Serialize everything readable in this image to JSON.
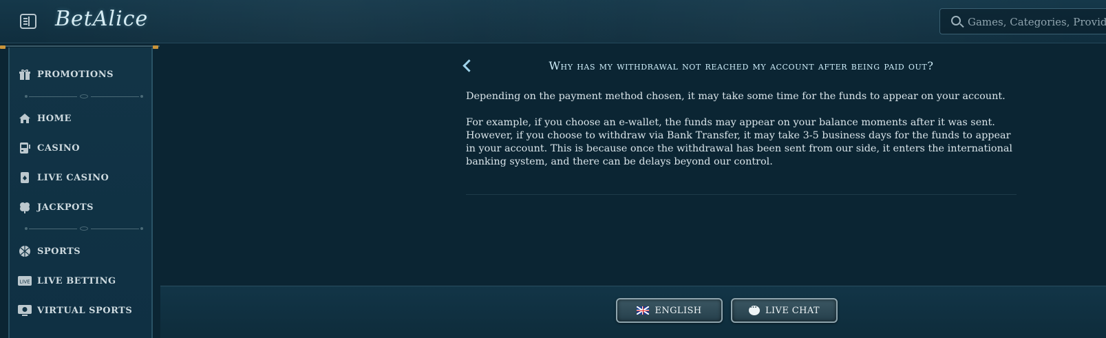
{
  "header": {
    "logo_text": "BetAlice",
    "search": {
      "placeholder": "Games, Categories, Providers"
    }
  },
  "sidebar": {
    "items": [
      {
        "label": "PROMOTIONS",
        "icon": "gift-icon"
      },
      {
        "label": "HOME",
        "icon": "home-icon"
      },
      {
        "label": "CASINO",
        "icon": "slot-machine-icon"
      },
      {
        "label": "LIVE CASINO",
        "icon": "playing-card-icon"
      },
      {
        "label": "JACKPOTS",
        "icon": "clover-icon"
      },
      {
        "label": "SPORTS",
        "icon": "ball-icon"
      },
      {
        "label": "LIVE BETTING",
        "icon": "live-icon"
      },
      {
        "label": "VIRTUAL SPORTS",
        "icon": "virtual-sports-icon"
      }
    ]
  },
  "article": {
    "title": "Why has my withdrawal not reached my account after being paid out?",
    "paragraphs": [
      "Depending on the payment method chosen, it may take some time for the funds to appear on your account.",
      "For example, if you choose an e-wallet, the funds may appear on your balance moments after it was sent. However, if you choose to withdraw via Bank Transfer, it may take 3-5 business days for the funds to appear in your account. This is because once the withdrawal has been sent from our side, it enters the international banking system, and there can be delays beyond our control."
    ]
  },
  "footer": {
    "language_label": "ENGLISH",
    "chat_label": "LIVE CHAT"
  },
  "colors": {
    "background": "#0b2533",
    "title": "#cfeefa",
    "accent_cap": "#c9943a"
  }
}
